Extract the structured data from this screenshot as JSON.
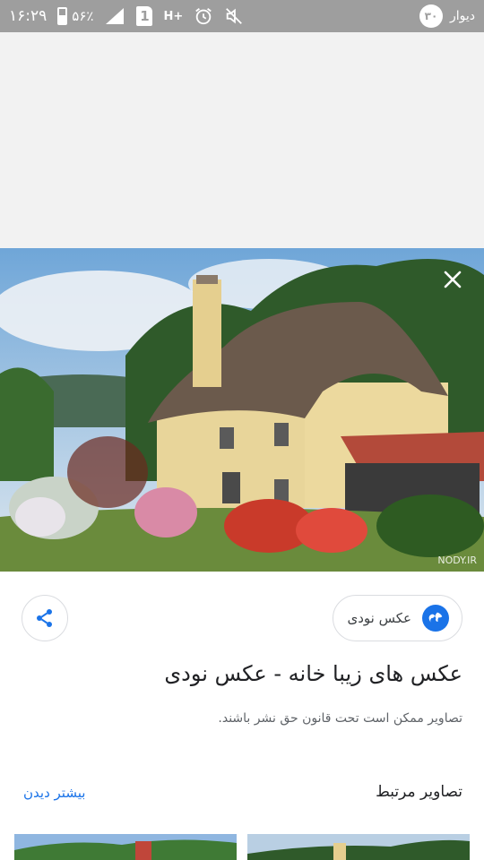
{
  "status_bar": {
    "time": "۱۶:۲۹",
    "battery": "۵۶٪",
    "battery_level": 0.56,
    "sim_number": "1",
    "network": "H+",
    "app_name": "دیوار",
    "badge": "۳۰",
    "icons": [
      "battery-icon",
      "signal-icon",
      "sim-icon",
      "network-h-plus-icon",
      "alarm-icon",
      "mute-icon"
    ]
  },
  "viewer": {
    "close_icon": "close-icon",
    "watermark": "NODY.IR"
  },
  "source": {
    "label": "عکس نودی",
    "icon": "globe-icon"
  },
  "share": {
    "icon": "share-icon"
  },
  "title": "عکس های زیبا خانه - عکس نودی",
  "notice": "تصاویر ممکن است تحت قانون حق نشر باشند.",
  "related": {
    "heading": "تصاویر مرتبط",
    "see_more": "بیشتر دیدن"
  },
  "colors": {
    "accent": "#1a73e8",
    "status_bar": "#9e9e9e",
    "text_primary": "#202124",
    "text_secondary": "#5f6368"
  }
}
